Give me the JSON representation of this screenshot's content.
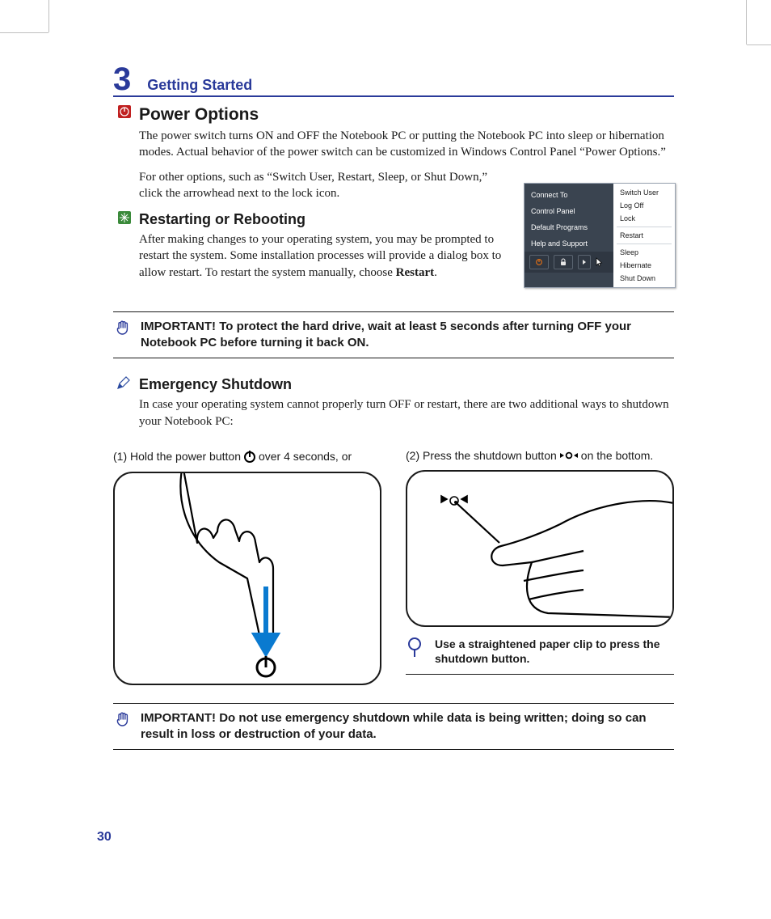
{
  "chapter": {
    "number": "3",
    "title": "Getting Started"
  },
  "power_options": {
    "heading": "Power Options",
    "para1": "The power switch turns ON and OFF the Notebook PC or putting the Notebook PC into sleep or hibernation modes. Actual behavior of the power switch can be customized in Windows Control Panel “Power Options.”",
    "para2": "For other options, such as “Switch User, Restart, Sleep, or Shut Down,” click the arrowhead next to the lock icon."
  },
  "restarting": {
    "heading": "Restarting or Rebooting",
    "para_pre": "After making changes to your operating system, you may be prompted to restart the system. Some installation processes will provide a dialog box to allow restart. To restart the system manually, choose ",
    "para_bold": "Restart",
    "para_post": "."
  },
  "start_menu": {
    "left": [
      "Connect To",
      "Control Panel",
      "Default Programs",
      "Help and Support"
    ],
    "right_top": [
      "Switch User",
      "Log Off",
      "Lock"
    ],
    "right_mid": [
      "Restart"
    ],
    "right_bot": [
      "Sleep",
      "Hibernate",
      "Shut Down"
    ]
  },
  "important1": "IMPORTANT!  To protect the hard drive, wait at least 5 seconds after turning OFF your Notebook PC before turning it back ON.",
  "emergency": {
    "heading": "Emergency Shutdown",
    "para": "In case your operating system cannot properly turn OFF or restart, there are two additional ways to shutdown your Notebook PC:",
    "method1_pre": "(1) Hold the power button ",
    "method1_post": " over 4 seconds, or",
    "method2_pre": "(2) Press the shutdown button ",
    "method2_post": " on the bottom."
  },
  "tip": "Use a straightened paper clip to press the shutdown button.",
  "important2": "IMPORTANT!  Do not use emergency shutdown while data is being written; doing so can result in loss or destruction of your data.",
  "page_number": "30",
  "icons": {
    "power_exclaim": "!",
    "snow": "*"
  }
}
